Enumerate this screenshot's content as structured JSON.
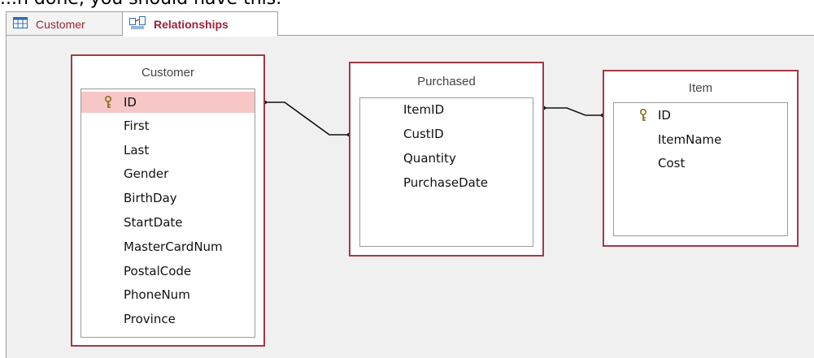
{
  "caption": "...n done, you should have this.",
  "tabs": [
    {
      "label": "Customer",
      "icon": "datasheet-icon"
    },
    {
      "label": "Relationships",
      "icon": "relationships-icon"
    }
  ],
  "tables": {
    "customer": {
      "title": "Customer",
      "fields": [
        "ID",
        "First",
        "Last",
        "Gender",
        "BirthDay",
        "StartDate",
        "MasterCardNum",
        "PostalCode",
        "PhoneNum",
        "Province"
      ],
      "primary_key": "ID"
    },
    "purchased": {
      "title": "Purchased",
      "fields": [
        "ItemID",
        "CustID",
        "Quantity",
        "PurchaseDate"
      ]
    },
    "item": {
      "title": "Item",
      "fields": [
        "ID",
        "ItemName",
        "Cost"
      ],
      "primary_key": "ID"
    }
  },
  "colors": {
    "table_border": "#a33a45",
    "tab_text": "#9d2235",
    "selected_row": "#f7c6c6",
    "canvas": "#f0f0f0"
  }
}
